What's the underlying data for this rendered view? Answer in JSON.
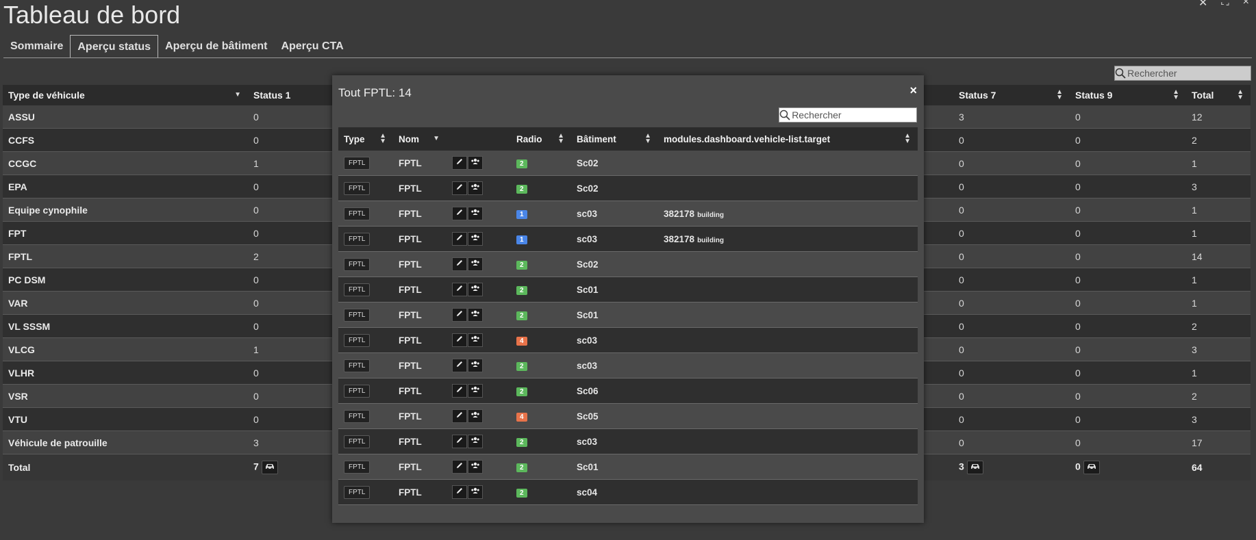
{
  "window": {
    "close": "✕",
    "maximize": "⛶",
    "minimize": "×"
  },
  "page_title": "Tableau de bord",
  "tabs": [
    {
      "label": "Sommaire",
      "active": false
    },
    {
      "label": "Aperçu status",
      "active": true
    },
    {
      "label": "Aperçu de bâtiment",
      "active": false
    },
    {
      "label": "Aperçu CTA",
      "active": false
    }
  ],
  "search": {
    "placeholder": "Rechercher"
  },
  "main_table": {
    "headers": {
      "type": "Type de véhicule",
      "status1": "Status 1",
      "status7": "Status 7",
      "status9": "Status 9",
      "total": "Total"
    },
    "rows": [
      {
        "type": "ASSU",
        "status1": "0",
        "status7": "3",
        "status9": "0",
        "total": "12"
      },
      {
        "type": "CCFS",
        "status1": "0",
        "status7": "0",
        "status9": "0",
        "total": "2"
      },
      {
        "type": "CCGC",
        "status1": "1",
        "status7": "0",
        "status9": "0",
        "total": "1"
      },
      {
        "type": "EPA",
        "status1": "0",
        "status7": "0",
        "status9": "0",
        "total": "3"
      },
      {
        "type": "Equipe cynophile",
        "status1": "0",
        "status7": "0",
        "status9": "0",
        "total": "1"
      },
      {
        "type": "FPT",
        "status1": "0",
        "status7": "0",
        "status9": "0",
        "total": "1"
      },
      {
        "type": "FPTL",
        "status1": "2",
        "status7": "0",
        "status9": "0",
        "total": "14"
      },
      {
        "type": "PC DSM",
        "status1": "0",
        "status7": "0",
        "status9": "0",
        "total": "1"
      },
      {
        "type": "VAR",
        "status1": "0",
        "status7": "0",
        "status9": "0",
        "total": "1"
      },
      {
        "type": "VL SSSM",
        "status1": "0",
        "status7": "0",
        "status9": "0",
        "total": "2"
      },
      {
        "type": "VLCG",
        "status1": "1",
        "status7": "0",
        "status9": "0",
        "total": "3"
      },
      {
        "type": "VLHR",
        "status1": "0",
        "status7": "0",
        "status9": "0",
        "total": "1"
      },
      {
        "type": "VSR",
        "status1": "0",
        "status7": "0",
        "status9": "0",
        "total": "2"
      },
      {
        "type": "VTU",
        "status1": "0",
        "status7": "0",
        "status9": "0",
        "total": "3"
      },
      {
        "type": "Véhicule de patrouille",
        "status1": "3",
        "status7": "0",
        "status9": "0",
        "total": "17"
      }
    ],
    "total_row": {
      "label": "Total",
      "status1": "7",
      "status7": "3",
      "status9": "0",
      "total": "64"
    }
  },
  "modal": {
    "title": "Tout FPTL: 14",
    "close": "×",
    "search_placeholder": "Rechercher",
    "headers": {
      "type": "Type",
      "nom": "Nom",
      "radio": "Radio",
      "batiment": "Bâtiment",
      "target": "modules.dashboard.vehicle-list.target"
    },
    "colors": {
      "radio_2": "#5cb85c",
      "radio_1": "#4a86e8",
      "radio_4": "#e8734a"
    },
    "rows": [
      {
        "type": "FPTL",
        "nom": "FPTL",
        "radio": "2",
        "batiment": "Sc02",
        "target": "",
        "target_sub": ""
      },
      {
        "type": "FPTL",
        "nom": "FPTL",
        "radio": "2",
        "batiment": "Sc02",
        "target": "",
        "target_sub": ""
      },
      {
        "type": "FPTL",
        "nom": "FPTL",
        "radio": "1",
        "batiment": "sc03",
        "target": "382178",
        "target_sub": "building"
      },
      {
        "type": "FPTL",
        "nom": "FPTL",
        "radio": "1",
        "batiment": "sc03",
        "target": "382178",
        "target_sub": "building"
      },
      {
        "type": "FPTL",
        "nom": "FPTL",
        "radio": "2",
        "batiment": "Sc02",
        "target": "",
        "target_sub": ""
      },
      {
        "type": "FPTL",
        "nom": "FPTL",
        "radio": "2",
        "batiment": "Sc01",
        "target": "",
        "target_sub": ""
      },
      {
        "type": "FPTL",
        "nom": "FPTL",
        "radio": "2",
        "batiment": "Sc01",
        "target": "",
        "target_sub": ""
      },
      {
        "type": "FPTL",
        "nom": "FPTL",
        "radio": "4",
        "batiment": "sc03",
        "target": "",
        "target_sub": ""
      },
      {
        "type": "FPTL",
        "nom": "FPTL",
        "radio": "2",
        "batiment": "sc03",
        "target": "",
        "target_sub": ""
      },
      {
        "type": "FPTL",
        "nom": "FPTL",
        "radio": "2",
        "batiment": "Sc06",
        "target": "",
        "target_sub": ""
      },
      {
        "type": "FPTL",
        "nom": "FPTL",
        "radio": "4",
        "batiment": "Sc05",
        "target": "",
        "target_sub": ""
      },
      {
        "type": "FPTL",
        "nom": "FPTL",
        "radio": "2",
        "batiment": "sc03",
        "target": "",
        "target_sub": ""
      },
      {
        "type": "FPTL",
        "nom": "FPTL",
        "radio": "2",
        "batiment": "Sc01",
        "target": "",
        "target_sub": ""
      },
      {
        "type": "FPTL",
        "nom": "FPTL",
        "radio": "2",
        "batiment": "sc04",
        "target": "",
        "target_sub": ""
      }
    ]
  }
}
